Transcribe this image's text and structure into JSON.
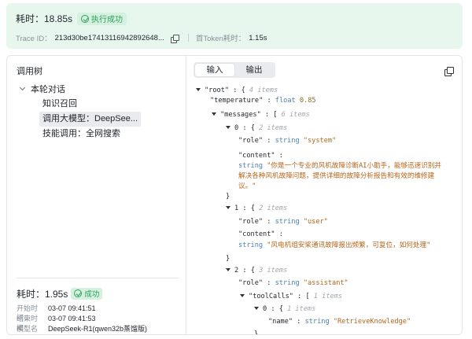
{
  "banner": {
    "elapsed_label": "耗时：18.85s",
    "status_label": "执行成功",
    "trace_label": "Trace ID：",
    "trace_value": "213d30be17413116942892648...",
    "first_token_label": "首Token耗时：",
    "first_token_value": "1.15s"
  },
  "tree_panel": {
    "title": "调用树",
    "root_label": "本轮对话",
    "items": [
      {
        "label": "知识召回",
        "selected": false
      },
      {
        "label": "调用大模型：DeepSee...",
        "selected": true
      },
      {
        "label": "技能调用：全网搜索",
        "selected": false
      }
    ]
  },
  "summary": {
    "elapsed_label": "耗时：1.95s",
    "status_label": "成功",
    "rows": [
      {
        "key": "开始时间：",
        "value": "03-07 09:41:51"
      },
      {
        "key": "结束时间：",
        "value": "03-07 09:41:53"
      },
      {
        "key": "模型名称：",
        "value": "DeepSeek-R1(qwen32b蒸馏版)"
      }
    ]
  },
  "tabs": [
    {
      "label": "输入",
      "active": true
    },
    {
      "label": "输出",
      "active": false
    }
  ],
  "json_view": {
    "root_key": "\"root\"",
    "root_meta": "4 items",
    "temperature_key": "\"temperature\"",
    "temperature_type": "float",
    "temperature_value": "0.85",
    "messages_key": "\"messages\"",
    "messages_meta": "6 items",
    "m0_index": "0",
    "m0_meta": "2 items",
    "m0_role_key": "\"role\"",
    "m0_role_type": "string",
    "m0_role_value": "\"system\"",
    "m0_content_key": "\"content\"",
    "m0_content_type": "string",
    "m0_content_value": "\"你是一个专业的风机故障诊断AI小助手，能够迅速识别并解决各种风机故障问题，提供详细的故障分析报告和有效的维修建议。\"",
    "m1_index": "1",
    "m1_meta": "2 items",
    "m1_role_key": "\"role\"",
    "m1_role_type": "string",
    "m1_role_value": "\"user\"",
    "m1_content_key": "\"content\"",
    "m1_content_type": "string",
    "m1_content_value": "\"风电机组安桨通讯故障报出频繁，可复位，如何处理\"",
    "m2_index": "2",
    "m2_meta": "3 items",
    "m2_role_key": "\"role\"",
    "m2_role_type": "string",
    "m2_role_value": "\"assistant\"",
    "toolcalls_key": "\"toolCalls\"",
    "toolcalls_meta": "1 items",
    "tc0_index": "0",
    "tc0_meta": "1 items",
    "tc0_name_key": "\"name\"",
    "tc0_name_type": "string",
    "tc0_name_value": "\"RetrieveKnowledge\""
  }
}
